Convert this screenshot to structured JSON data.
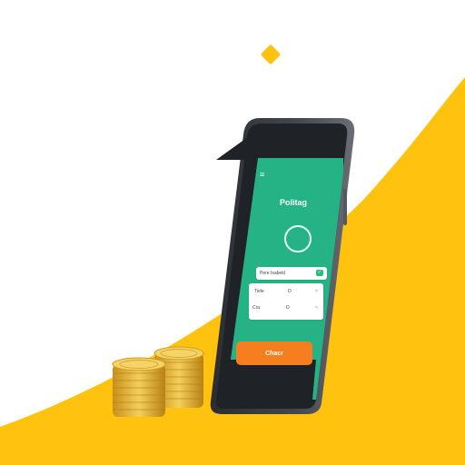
{
  "palette": {
    "background": "#ffffff",
    "accent_yellow": "#FFC20E",
    "screen_green": "#25B386",
    "button_orange": "#F57F1F",
    "phone_frame": "#3b3f45",
    "coin_gold": "#E8B83A"
  },
  "phone": {
    "menu_icon": "hamburger-menu-icon",
    "title": "Pᴏlitag",
    "status_icon": "ring-icon",
    "cards": [
      {
        "label": "Pere Isabeld",
        "value": ""
      },
      {
        "label": "Tiele",
        "mid": "D",
        "value": ""
      },
      {
        "label": "Cra",
        "mid": "O",
        "value": ""
      }
    ],
    "button_label": "Chacr"
  },
  "coins": {
    "icon": "gold-coin-stack-icon",
    "stacks": 2
  }
}
